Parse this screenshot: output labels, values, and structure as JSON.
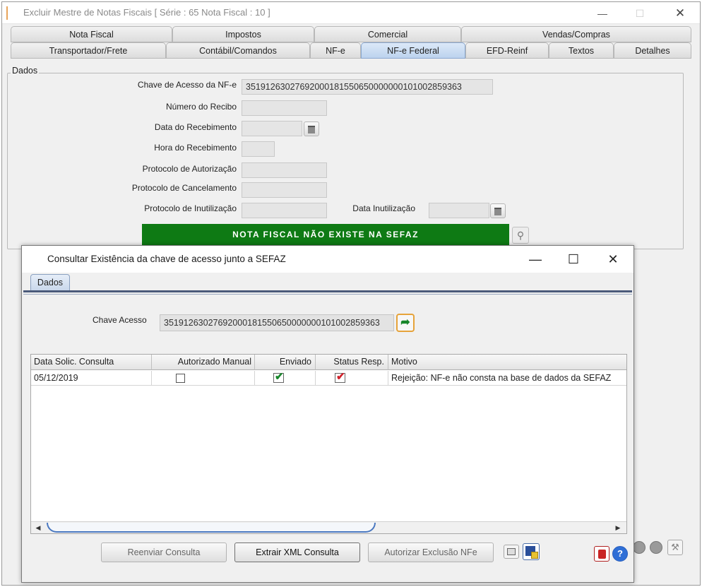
{
  "main_window": {
    "title": "Excluir Mestre de Notas Fiscais [ Série : 65  Nota Fiscal : 10 ]",
    "controls": {
      "minimize": "—",
      "maximize": "☐",
      "close": "✕"
    }
  },
  "tabs_row1": [
    "Nota Fiscal",
    "Impostos",
    "Comercial",
    "Vendas/Compras"
  ],
  "tabs_row2": [
    "Transportador/Frete",
    "Contábil/Comandos",
    "NF-e",
    "NF-e Federal",
    "EFD-Reinf",
    "Textos",
    "Detalhes"
  ],
  "active_tab": "NF-e Federal",
  "dados": {
    "group_label": "Dados",
    "chave_label": "Chave de Acesso da NF-e",
    "chave_value": "35191263027692000181550650000000101002859363",
    "recibo_label": "Número do Recibo",
    "data_receb_label": "Data do Recebimento",
    "hora_receb_label": "Hora do Recebimento",
    "prot_aut_label": "Protocolo de Autorização",
    "prot_canc_label": "Protocolo de Cancelamento",
    "prot_inut_label": "Protocolo de Inutilização",
    "data_inut_label": "Data Inutilização",
    "status_banner": "NOTA FISCAL NÃO EXISTE NA SEFAZ"
  },
  "dialog": {
    "title": "Consultar Existência da chave de acesso junto a SEFAZ",
    "controls": {
      "minimize": "—",
      "maximize": "☐",
      "close": "✕"
    },
    "tab": "Dados",
    "chave_label": "Chave Acesso",
    "chave_value": "35191263027692000181550650000000101002859363",
    "grid": {
      "columns": [
        "Data Solic. Consulta",
        "Autorizado Manual",
        "Enviado",
        "Status Resp.",
        "Motivo"
      ],
      "rows": [
        {
          "data": "05/12/2019",
          "autorizado_manual": false,
          "enviado": true,
          "status_resp": true,
          "motivo": "Rejeição: NF-e não consta na base de dados da SEFAZ"
        }
      ]
    },
    "buttons": {
      "reenviar": "Reenviar Consulta",
      "extrair": "Extrair XML Consulta",
      "autorizar": "Autorizar Exclusão NFe"
    }
  },
  "colors": {
    "banner_green": "#0e7a14",
    "tick_green": "#17862a",
    "tick_red": "#d0202a",
    "focus_orange": "#e6a33a"
  }
}
